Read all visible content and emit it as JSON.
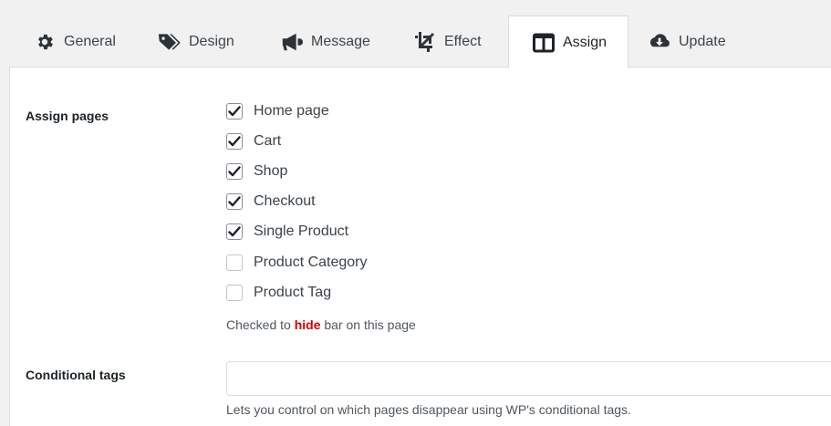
{
  "tabs": [
    {
      "label": "General",
      "icon": "gear-icon"
    },
    {
      "label": "Design",
      "icon": "tags-icon"
    },
    {
      "label": "Message",
      "icon": "megaphone-icon"
    },
    {
      "label": "Effect",
      "icon": "crop-icon"
    },
    {
      "label": "Assign",
      "icon": "columns-icon",
      "active": true
    },
    {
      "label": "Update",
      "icon": "cloud-download-icon"
    }
  ],
  "assign_pages": {
    "label": "Assign pages",
    "options": [
      {
        "label": "Home page",
        "checked": true
      },
      {
        "label": "Cart",
        "checked": true
      },
      {
        "label": "Shop",
        "checked": true
      },
      {
        "label": "Checkout",
        "checked": true
      },
      {
        "label": "Single Product",
        "checked": true
      },
      {
        "label": "Product Category",
        "checked": false
      },
      {
        "label": "Product Tag",
        "checked": false
      }
    ],
    "note_prefix": "Checked to",
    "note_highlight": "hide",
    "note_suffix": "bar on this page"
  },
  "conditional_tags": {
    "label": "Conditional tags",
    "value": "",
    "help": "Lets you control on which pages disappear using WP's conditional tags."
  },
  "colors": {
    "accent_highlight": "#d40000",
    "panel_bg": "#ffffff",
    "page_bg": "#f1f1f1"
  }
}
